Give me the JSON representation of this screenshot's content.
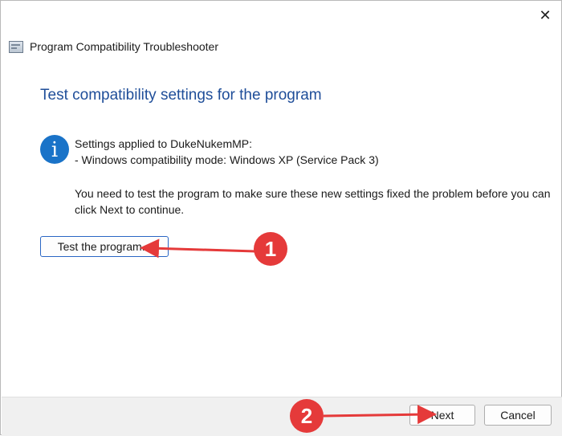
{
  "window": {
    "title": "Program Compatibility Troubleshooter",
    "close_glyph": "✕",
    "close_icon": "close-icon",
    "app_icon": "troubleshooter-app-icon"
  },
  "main": {
    "heading": "Test compatibility settings for the program",
    "info_icon": "info-icon",
    "info_glyph": "i",
    "settings_line1": "Settings applied to DukeNukemMP:",
    "settings_line2": "- Windows compatibility mode: Windows XP (Service Pack 3)",
    "instructions": "You need to test the program to make sure these new settings fixed the problem before you can click Next to continue.",
    "test_button_label": "Test the program..."
  },
  "footer": {
    "next_label": "Next",
    "cancel_label": "Cancel"
  },
  "annotations": {
    "step1": "1",
    "step2": "2",
    "color": "#e53a3a"
  }
}
